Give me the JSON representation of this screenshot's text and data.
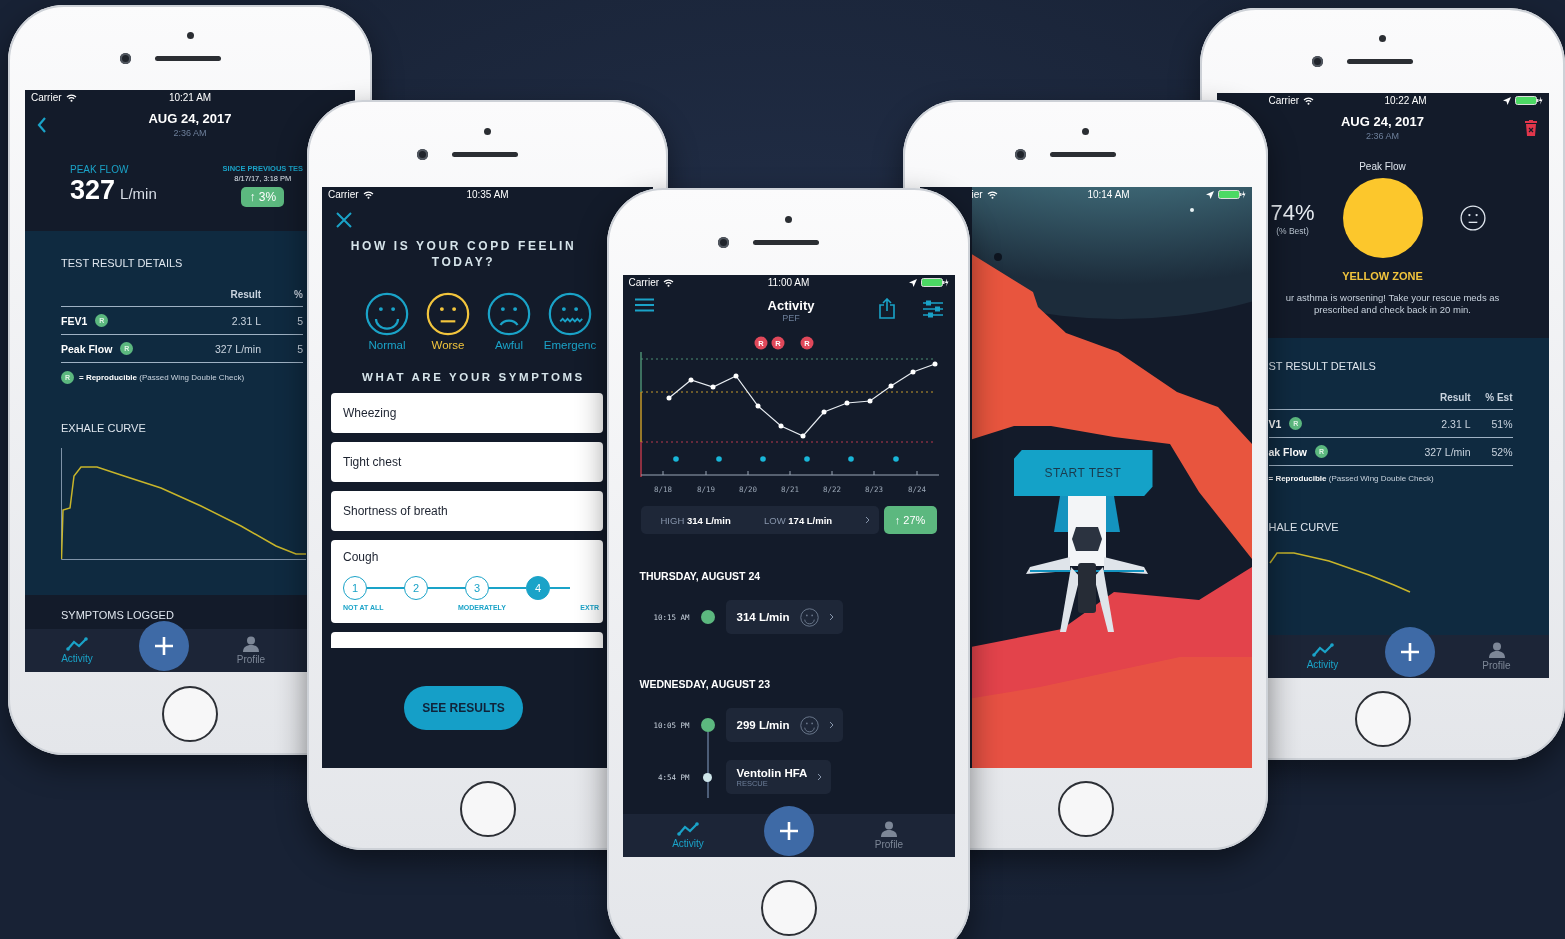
{
  "result_screen": {
    "status_bar": {
      "carrier": "Carrier",
      "time": "10:21 AM"
    },
    "header": {
      "date": "AUG 24, 2017",
      "time": "2:36 AM"
    },
    "peak_flow": {
      "label": "PEAK FLOW",
      "value": "327",
      "unit": "L/min"
    },
    "change": {
      "label": "SINCE PREVIOUS TES",
      "date": "8/17/17, 3:18 PM",
      "badge": "↑ 3%"
    },
    "details": {
      "title": "TEST RESULT DETAILS",
      "columns": [
        "Result",
        "%"
      ],
      "rows": [
        {
          "name": "FEV1",
          "badge": "R",
          "result": "2.31 L",
          "est": "5"
        },
        {
          "name": "Peak Flow",
          "badge": "R",
          "result": "327 L/min",
          "est": "5"
        }
      ],
      "legend": {
        "badge": "R",
        "text": "**= Reproducible** (Passed Wing Double Check)"
      }
    },
    "exhale_curve": {
      "title": "EXHALE CURVE"
    },
    "symptoms": {
      "title": "SYMPTOMS LOGGED"
    },
    "tab_bar": {
      "tabs": [
        {
          "kind": "activity",
          "label": "Activity",
          "selected": true
        },
        {
          "kind": "profile",
          "label": "Profile",
          "selected": false
        }
      ]
    }
  },
  "symptom_screen": {
    "status_bar": {
      "carrier": "Carrier",
      "time": "10:35 AM"
    },
    "question": [
      "HOW IS YOUR COPD FEELIN",
      "TODAY?"
    ],
    "moods": [
      {
        "kind": "smile",
        "label": "Normal",
        "selected": false
      },
      {
        "kind": "neutral",
        "label": "Worse",
        "selected": true
      },
      {
        "kind": "frown",
        "label": "Awful",
        "selected": false
      },
      {
        "kind": "distress",
        "label": "Emergenc",
        "selected": false
      }
    ],
    "symptoms_title": "WHAT ARE YOUR SYMPTOMS",
    "symptoms": [
      {
        "kind": "plain",
        "label": "Wheezing"
      },
      {
        "kind": "plain",
        "label": "Tight chest"
      },
      {
        "kind": "plain",
        "label": "Shortness of breath"
      },
      {
        "kind": "scale",
        "label": "Cough",
        "steps": [
          {
            "label": "1",
            "selected": false
          },
          {
            "label": "2",
            "selected": false
          },
          {
            "label": "3",
            "selected": false
          },
          {
            "label": "4",
            "selected": true
          }
        ],
        "scale_labels": [
          "NOT AT ALL",
          "MODERATELY",
          "EXTR"
        ]
      }
    ],
    "button": "SEE RESULTS"
  },
  "activity_screen": {
    "status_bar": {
      "carrier": "Carrier",
      "time": "11:00 AM"
    },
    "title": "Activity",
    "subtitle": "PEF",
    "chart_badges": [
      "R",
      "R",
      "R"
    ],
    "chart_labels": [
      "8/18",
      "8/19",
      "8/20",
      "8/21",
      "8/22",
      "8/23",
      "8/24"
    ],
    "stats": {
      "high_label": "HIGH",
      "high": "314 L/min",
      "low_label": "LOW",
      "low": "174 L/min",
      "change": "↑ 27%"
    },
    "days": [
      {
        "title": "THURSDAY, AUGUST 24",
        "entries": [
          {
            "kind": "reading",
            "time": "10:15 AM",
            "value": "314 L/min",
            "color": "#5cb87f"
          }
        ]
      },
      {
        "title": "WEDNESDAY, AUGUST 23",
        "entries": [
          {
            "kind": "reading",
            "time": "10:05 PM",
            "value": "299 L/min",
            "color": "#5cb87f"
          },
          {
            "kind": "medication",
            "time": "4:54 PM",
            "value": "Ventolin HFA",
            "note": "RESCUE",
            "color": "#cfe6ea"
          }
        ]
      }
    ],
    "tab_bar": {
      "tabs": [
        {
          "kind": "activity",
          "label": "Activity",
          "selected": true
        },
        {
          "kind": "profile",
          "label": "Profile",
          "selected": false
        }
      ]
    }
  },
  "start_screen": {
    "status_bar": {
      "carrier": "ier",
      "time": "10:14 AM"
    },
    "button": "START TEST"
  },
  "zone_screen": {
    "status_bar": {
      "carrier": "Carrier",
      "time": "10:22 AM"
    },
    "header": {
      "date": "AUG 24, 2017",
      "time": "2:36 AM"
    },
    "label": "Peak Flow",
    "percent": "74%",
    "percent_note": "(% Best)",
    "zone": "YELLOW ZONE",
    "message": "ur asthma is worsening! Take your rescue meds as prescribed and check back in 20 min.",
    "details": {
      "title": "ST RESULT DETAILS",
      "columns": [
        "Result",
        "% Est"
      ],
      "rows": [
        {
          "name": "V1",
          "badge": "R",
          "result": "2.31 L",
          "est": "51%"
        },
        {
          "name": "ak Flow",
          "badge": "R",
          "result": "327 L/min",
          "est": "52%"
        }
      ],
      "legend": {
        "text": "**= Reproducible** (Passed Wing Double Check)"
      }
    },
    "exhale_curve": {
      "title": "HALE CURVE"
    },
    "tab_bar": {
      "tabs": [
        {
          "kind": "activity",
          "label": "Activity",
          "selected": true
        },
        {
          "kind": "profile",
          "label": "Profile",
          "selected": false
        }
      ]
    }
  }
}
